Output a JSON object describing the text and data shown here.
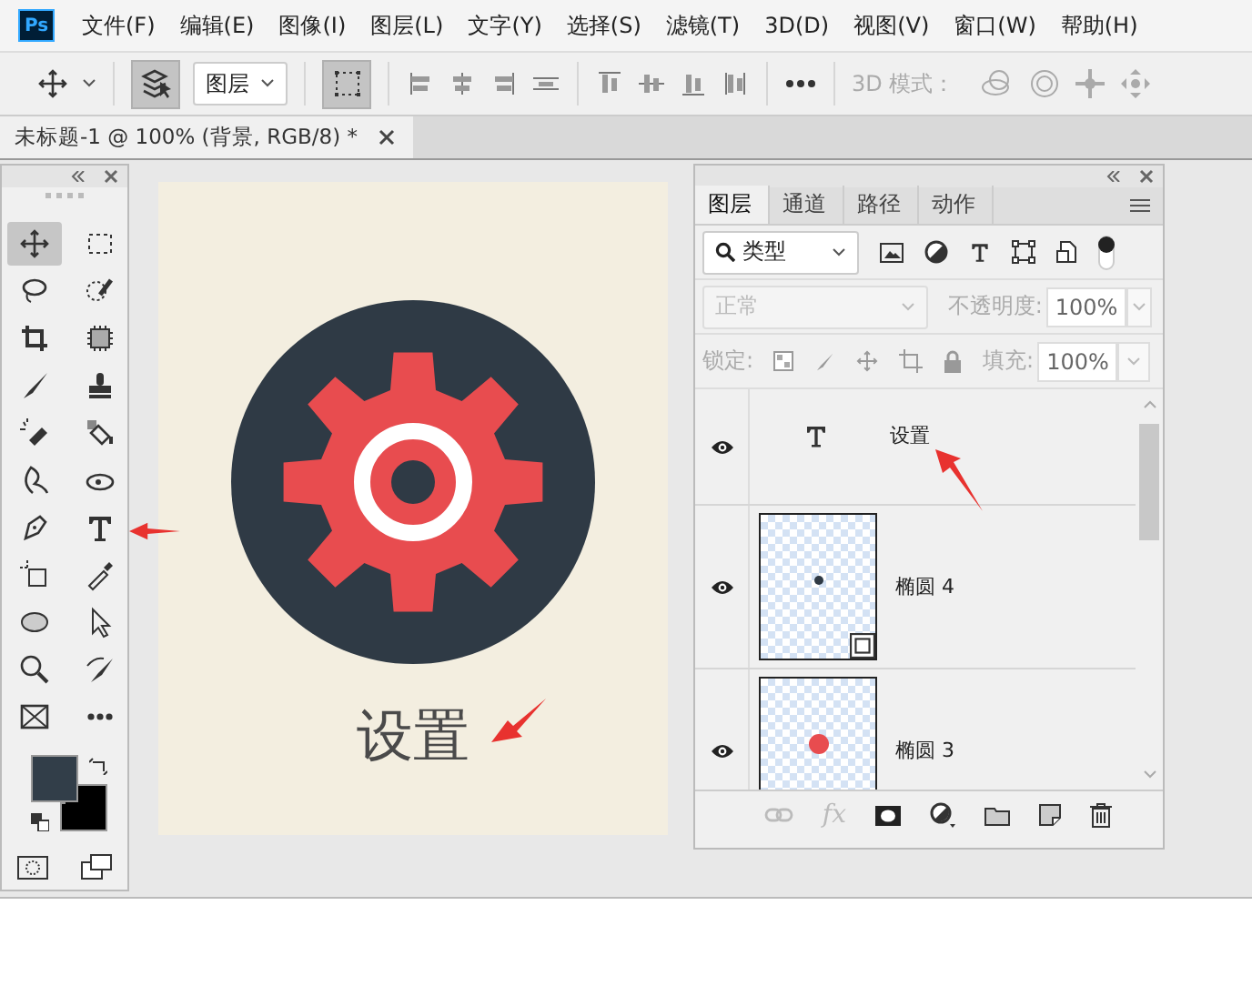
{
  "app_icon": "Ps",
  "menu": [
    "文件(F)",
    "编辑(E)",
    "图像(I)",
    "图层(L)",
    "文字(Y)",
    "选择(S)",
    "滤镜(T)",
    "3D(D)",
    "视图(V)",
    "窗口(W)",
    "帮助(H)"
  ],
  "options_bar": {
    "auto_select": true,
    "target": "图层",
    "show_transform": true,
    "mode_label": "3D 模式："
  },
  "document_tab": {
    "title": "未标题-1 @ 100% (背景, RGB/8) *"
  },
  "tools": [
    {
      "kind": "move",
      "selected": true
    },
    {
      "kind": "marquee",
      "selected": false
    },
    {
      "kind": "lasso",
      "selected": false
    },
    {
      "kind": "quick-select",
      "selected": false
    },
    {
      "kind": "crop",
      "selected": false
    },
    {
      "kind": "frame",
      "selected": false
    },
    {
      "kind": "brush",
      "selected": false
    },
    {
      "kind": "stamp",
      "selected": false
    },
    {
      "kind": "eraser",
      "selected": false
    },
    {
      "kind": "fill",
      "selected": false
    },
    {
      "kind": "smudge",
      "selected": false
    },
    {
      "kind": "dodge",
      "selected": false
    },
    {
      "kind": "pen",
      "selected": false
    },
    {
      "kind": "type",
      "selected": false
    },
    {
      "kind": "path-select",
      "selected": false
    },
    {
      "kind": "eyedropper",
      "selected": false
    },
    {
      "kind": "ellipse",
      "selected": false
    },
    {
      "kind": "arrow",
      "selected": false
    },
    {
      "kind": "zoom",
      "selected": false
    },
    {
      "kind": "heal",
      "selected": false
    },
    {
      "kind": "frame-x",
      "selected": false
    },
    {
      "kind": "more",
      "selected": false
    }
  ],
  "canvas": {
    "caption": "设置"
  },
  "layers_panel": {
    "tabs": [
      {
        "label": "图层",
        "selected": true
      },
      {
        "label": "通道",
        "selected": false
      },
      {
        "label": "路径",
        "selected": false
      },
      {
        "label": "动作",
        "selected": false
      }
    ],
    "filter": "类型",
    "filter_on": true,
    "blend_mode": {
      "value": "正常",
      "disabled": true
    },
    "opacity_label": "不透明度:",
    "opacity": "100%",
    "lock_label": "锁定:",
    "fill_label": "填充:",
    "fill": "100%",
    "layers": [
      {
        "kind": "text",
        "name": "设置",
        "visible": true
      },
      {
        "kind": "shape",
        "name": "椭圆 4",
        "visible": true,
        "color": "#2f3a45",
        "badge": true
      },
      {
        "kind": "shape",
        "name": "椭圆 3",
        "visible": true,
        "color": "#e84c4f"
      }
    ],
    "effects_button": "fx"
  }
}
